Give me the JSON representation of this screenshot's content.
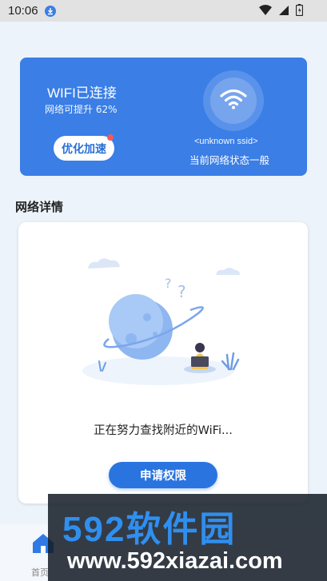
{
  "status_bar": {
    "time": "10:06"
  },
  "wifi_card": {
    "title": "WIFI已连接",
    "subtitle": "网络可提升 62%",
    "boost_label": "优化加速",
    "ssid": "<unknown ssid>",
    "network_status": "当前网络状态一般"
  },
  "section": {
    "title": "网络详情"
  },
  "detail": {
    "searching_text": "正在努力查找附近的WiFi...",
    "apply_label": "申请权限"
  },
  "nav": {
    "home_label": "首页"
  },
  "watermark": {
    "brand": "592软件园",
    "url": "www.592xiazai.com"
  },
  "colors": {
    "primary": "#3a7ee6",
    "accent_red": "#f25a5a",
    "background": "#ecf3fb"
  }
}
